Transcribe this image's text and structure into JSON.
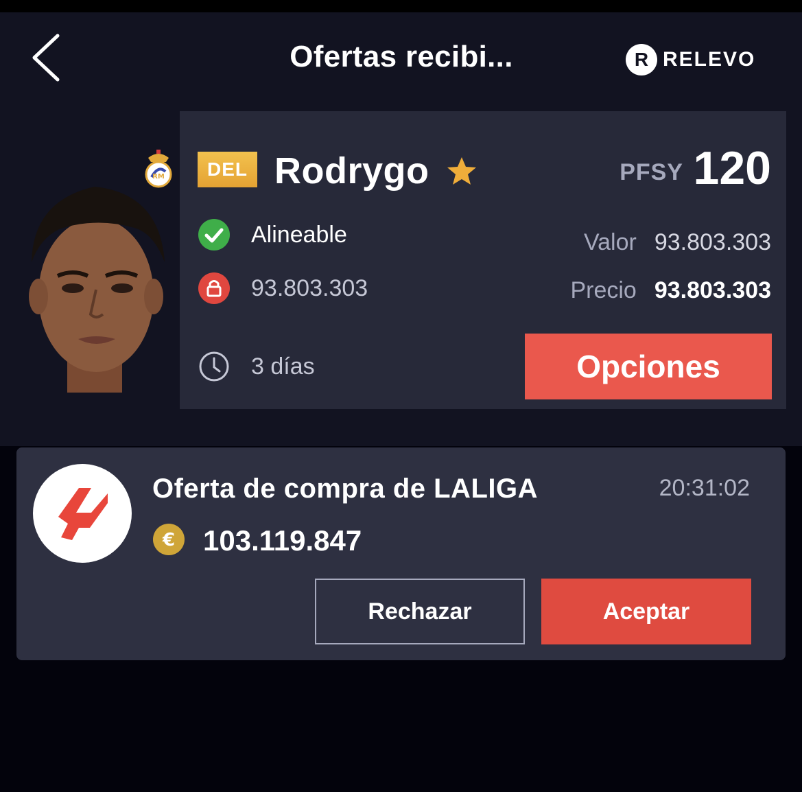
{
  "header": {
    "title": "Ofertas recibi...",
    "brand_badge": "R",
    "brand_name": "RELEVO"
  },
  "player": {
    "position": "DEL",
    "name": "Rodrygo",
    "pfsy_label": "PFSY",
    "pfsy_value": "120",
    "status_label": "Alineable",
    "clause_value": "93.803.303",
    "days_left": "3 días",
    "value_label": "Valor",
    "value_amount": "93.803.303",
    "price_label": "Precio",
    "price_amount": "93.803.303",
    "options_label": "Opciones"
  },
  "offer": {
    "title": "Oferta de compra de LALIGA",
    "time": "20:31:02",
    "amount": "103.119.847",
    "reject_label": "Rechazar",
    "accept_label": "Aceptar"
  },
  "icons": {
    "back": "chevron-left-icon",
    "favorite": "star-icon",
    "status": "check-circle-icon",
    "clause": "lock-icon",
    "time": "clock-icon",
    "currency": "euro-coin-icon"
  },
  "colors": {
    "header_bg": "#121321",
    "card_bg": "#272939",
    "offer_bg": "#2e3041",
    "accent_red": "#ea584d",
    "badge_gold": "#e4a233",
    "status_green": "#3fae49"
  }
}
